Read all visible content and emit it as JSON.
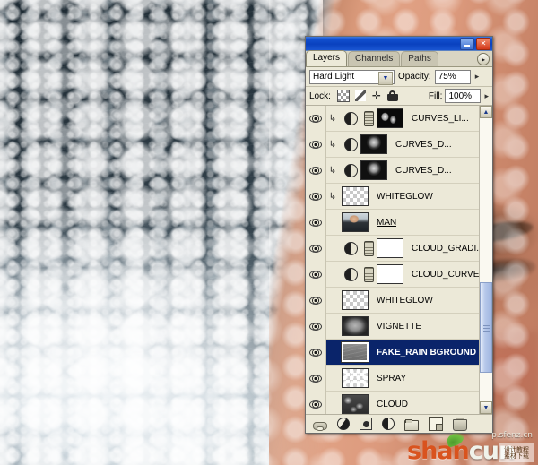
{
  "window": {
    "title": "",
    "minimize_label": "—",
    "close_label": "✕"
  },
  "tabs": [
    {
      "label": "Layers",
      "active": true
    },
    {
      "label": "Channels",
      "active": false
    },
    {
      "label": "Paths",
      "active": false
    }
  ],
  "panel_menu_icon": "triangle-right-icon",
  "blend": {
    "mode": "Hard Light",
    "dropdown_icon": "chevron-down-icon",
    "opacity_label": "Opacity:",
    "opacity_value": "75%",
    "opacity_spinner_icon": "spinner-arrow-icon"
  },
  "lock": {
    "label": "Lock:",
    "icons": [
      {
        "name": "lock-transparent-pixels-icon",
        "glyph": ""
      },
      {
        "name": "lock-image-pixels-icon",
        "glyph": ""
      },
      {
        "name": "lock-position-icon",
        "glyph": "✛"
      },
      {
        "name": "lock-all-icon",
        "glyph": ""
      }
    ],
    "fill_label": "Fill:",
    "fill_value": "100%",
    "fill_spinner_icon": "spinner-arrow-icon"
  },
  "layers": [
    {
      "name": "CURVES_LI...",
      "visible": true,
      "clipped": true,
      "selected": false,
      "kind": "adjustment",
      "thumb": "curvesmask-a",
      "has_link": true,
      "has_adj_icon": true,
      "underline": false
    },
    {
      "name": "CURVES_D...",
      "visible": true,
      "clipped": true,
      "selected": false,
      "kind": "adjustment",
      "thumb": "curvesmask-b",
      "has_link": false,
      "has_adj_icon": true,
      "underline": false
    },
    {
      "name": "CURVES_D...",
      "visible": true,
      "clipped": true,
      "selected": false,
      "kind": "adjustment",
      "thumb": "curvesmask-b",
      "has_link": false,
      "has_adj_icon": true,
      "underline": false
    },
    {
      "name": "WHITEGLOW",
      "visible": true,
      "clipped": true,
      "selected": false,
      "kind": "pixel",
      "thumb": "checker",
      "has_link": false,
      "has_adj_icon": false,
      "underline": false
    },
    {
      "name": "MAN",
      "visible": true,
      "clipped": false,
      "selected": false,
      "kind": "pixel",
      "thumb": "man",
      "has_link": false,
      "has_adj_icon": false,
      "underline": true
    },
    {
      "name": "CLOUD_GRADI...",
      "visible": true,
      "clipped": false,
      "selected": false,
      "kind": "adjustment",
      "thumb": "white",
      "has_link": true,
      "has_adj_icon": true,
      "underline": false
    },
    {
      "name": "CLOUD_CURVES",
      "visible": true,
      "clipped": false,
      "selected": false,
      "kind": "adjustment",
      "thumb": "white",
      "has_link": true,
      "has_adj_icon": true,
      "underline": false
    },
    {
      "name": "WHITEGLOW",
      "visible": true,
      "clipped": false,
      "selected": false,
      "kind": "pixel",
      "thumb": "checker",
      "has_link": false,
      "has_adj_icon": false,
      "underline": false
    },
    {
      "name": "VIGNETTE",
      "visible": true,
      "clipped": false,
      "selected": false,
      "kind": "pixel",
      "thumb": "vignette",
      "has_link": false,
      "has_adj_icon": false,
      "underline": false
    },
    {
      "name": "FAKE_RAIN BGROUND",
      "visible": true,
      "clipped": false,
      "selected": true,
      "kind": "pixel",
      "thumb": "fakerain",
      "has_link": false,
      "has_adj_icon": false,
      "underline": false
    },
    {
      "name": "SPRAY",
      "visible": true,
      "clipped": false,
      "selected": false,
      "kind": "pixel",
      "thumb": "spray",
      "has_link": false,
      "has_adj_icon": false,
      "underline": false
    },
    {
      "name": "CLOUD",
      "visible": true,
      "clipped": false,
      "selected": false,
      "kind": "pixel",
      "thumb": "cloud",
      "has_link": false,
      "has_adj_icon": false,
      "underline": false
    }
  ],
  "scrollbar": {
    "up_icon": "chevron-up-icon",
    "down_icon": "chevron-down-icon",
    "thumb_top_pct": 58,
    "thumb_height_pct": 32
  },
  "bottom_toolbar": [
    {
      "name": "link-layers-button",
      "icon": "chain-link-icon"
    },
    {
      "name": "layer-style-button",
      "icon": "fx-circle-icon"
    },
    {
      "name": "add-layer-mask-button",
      "icon": "mask-icon"
    },
    {
      "name": "new-adjustment-layer-button",
      "icon": "half-circle-icon"
    },
    {
      "name": "new-group-button",
      "icon": "folder-icon"
    },
    {
      "name": "new-layer-button",
      "icon": "new-page-icon"
    },
    {
      "name": "delete-layer-button",
      "icon": "trash-icon"
    }
  ],
  "watermark": {
    "brand_first": "shan",
    "brand_second": "cun",
    "url": "p.sfenz.cn",
    "cn_line1": "设计教程",
    "cn_line2": "素材下载",
    "leaf_icon": "leaf-icon"
  },
  "colors": {
    "panel_bg": "#ece9d8",
    "selection_blue": "#0a246a",
    "titlebar_blue": "#0a41bf",
    "brand_orange": "#d9531e"
  }
}
